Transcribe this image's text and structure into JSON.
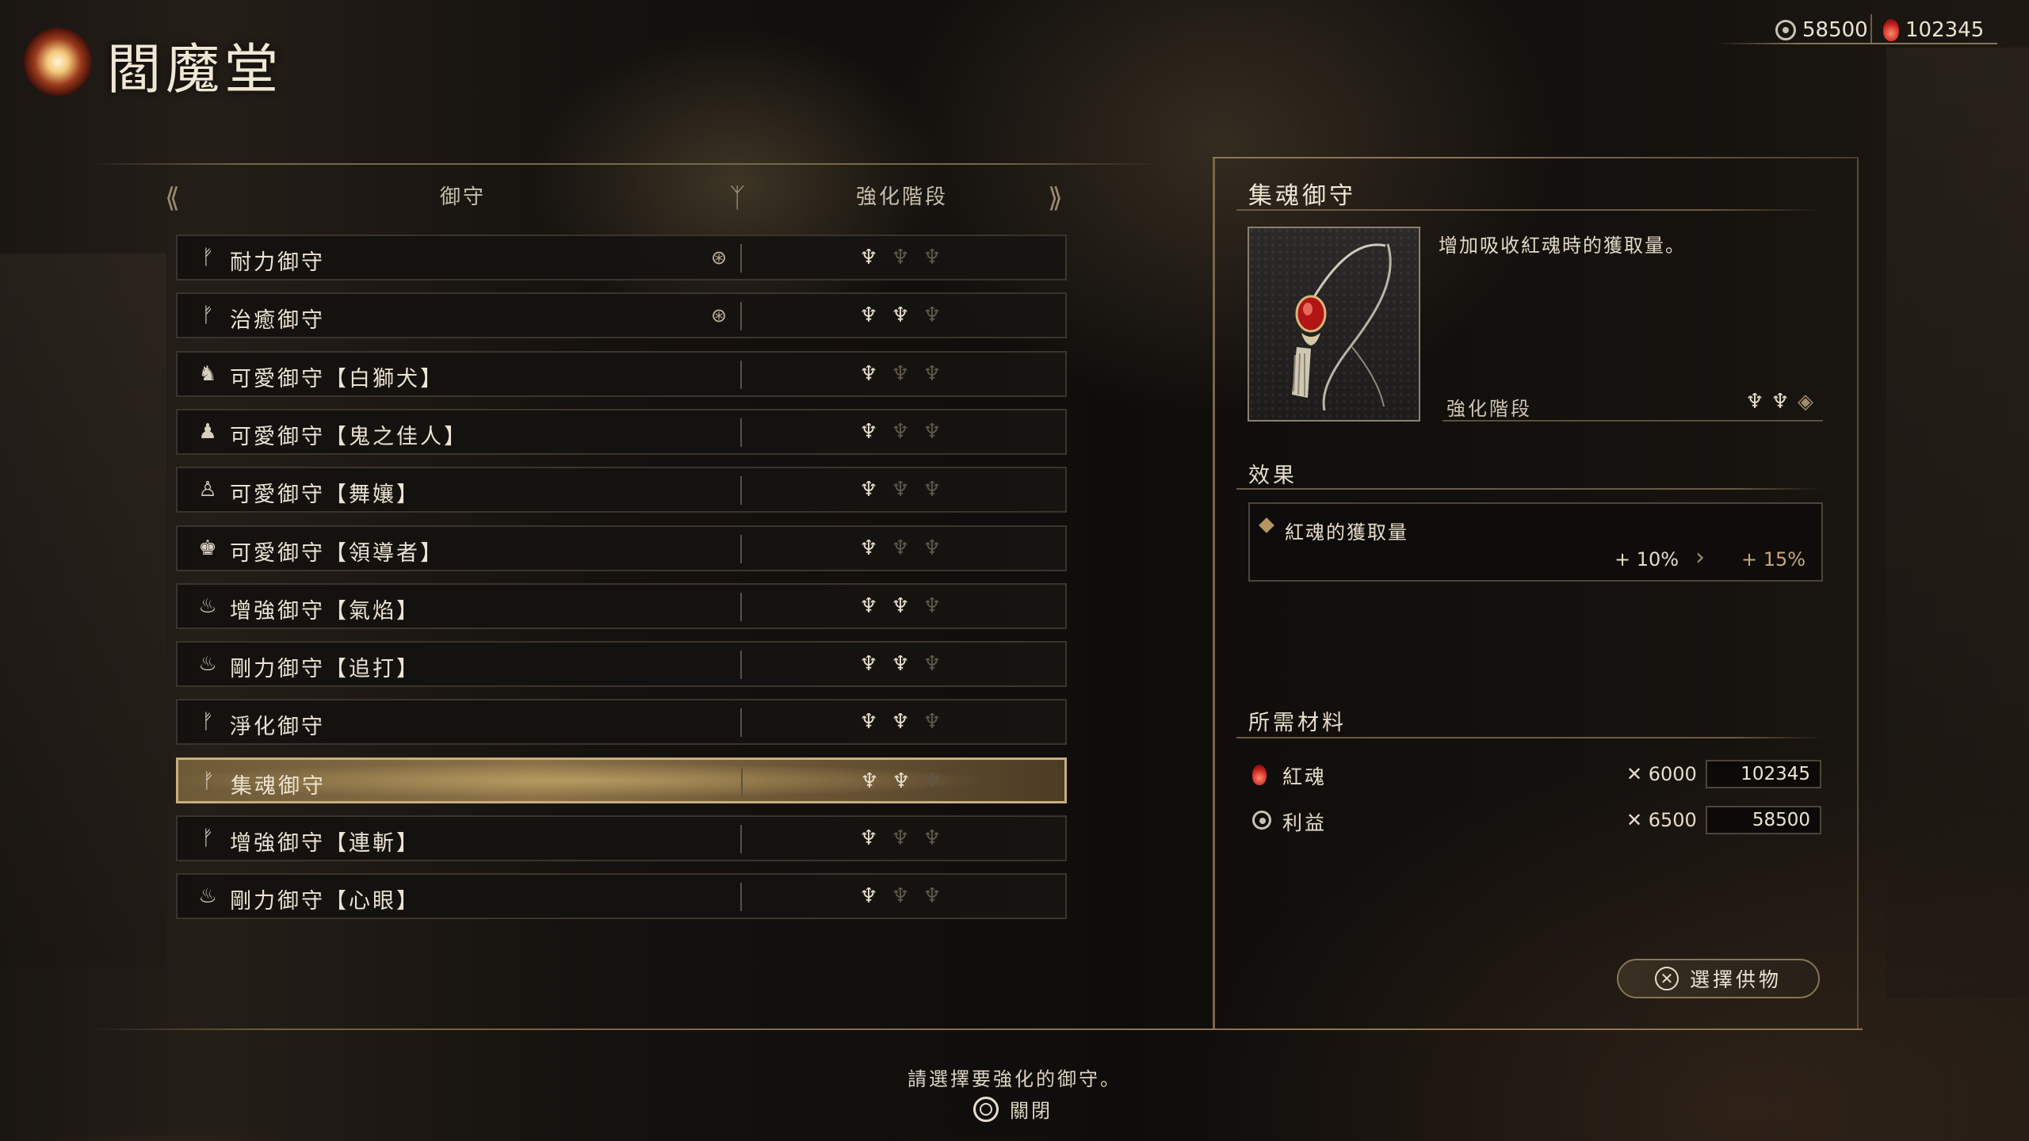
{
  "header": {
    "title": "閻魔堂",
    "currency": [
      {
        "icon": "amrita-icon",
        "value": "58500"
      },
      {
        "icon": "red-spirit-icon",
        "value": "102345"
      }
    ]
  },
  "list": {
    "columns": {
      "name": "御守",
      "stage": "強化階段"
    },
    "items": [
      {
        "icon": "charm-icon",
        "name": "耐力御守",
        "equipped": true,
        "stage": 1
      },
      {
        "icon": "charm-icon",
        "name": "治癒御守",
        "equipped": true,
        "stage": 2
      },
      {
        "icon": "lion-dog-icon",
        "name": "可愛御守【白獅犬】",
        "equipped": false,
        "stage": 1
      },
      {
        "icon": "lady-icon",
        "name": "可愛御守【鬼之佳人】",
        "equipped": false,
        "stage": 1
      },
      {
        "icon": "dancer-icon",
        "name": "可愛御守【舞孃】",
        "equipped": false,
        "stage": 1
      },
      {
        "icon": "leader-icon",
        "name": "可愛御守【領導者】",
        "equipped": false,
        "stage": 1
      },
      {
        "icon": "charm-bag-icon",
        "name": "增強御守【氣焰】",
        "equipped": false,
        "stage": 2
      },
      {
        "icon": "charm-bag-icon",
        "name": "剛力御守【追打】",
        "equipped": false,
        "stage": 2
      },
      {
        "icon": "charm-icon",
        "name": "淨化御守",
        "equipped": false,
        "stage": 2
      },
      {
        "icon": "charm-icon",
        "name": "集魂御守",
        "equipped": false,
        "stage": 2,
        "selected": true
      },
      {
        "icon": "charm-icon",
        "name": "增強御守【連斬】",
        "equipped": false,
        "stage": 1
      },
      {
        "icon": "charm-bag-icon",
        "name": "剛力御守【心眼】",
        "equipped": false,
        "stage": 1
      }
    ],
    "max_stage": 3
  },
  "detail": {
    "title": "集魂御守",
    "description": "增加吸收紅魂時的獲取量。",
    "stage_label": "強化階段",
    "stage_current": 2,
    "effects_title": "效果",
    "effects": [
      {
        "name": "紅魂的獲取量",
        "current": "+ 10%",
        "next": "+ 15%"
      }
    ],
    "materials_title": "所需材料",
    "materials": [
      {
        "icon": "red-spirit-icon",
        "name": "紅魂",
        "required": "✕ 6000",
        "have": "102345"
      },
      {
        "icon": "amrita-icon",
        "name": "利益",
        "required": "✕ 6500",
        "have": "58500"
      }
    ],
    "offer_button": "選擇供物"
  },
  "footer": {
    "hint": "請選擇要強化的御守。",
    "close_label": "關閉"
  },
  "colors": {
    "accent_gold": "#c8ae7a",
    "selected_row": "#8b7247",
    "red_spirit": "#c21b1b"
  }
}
